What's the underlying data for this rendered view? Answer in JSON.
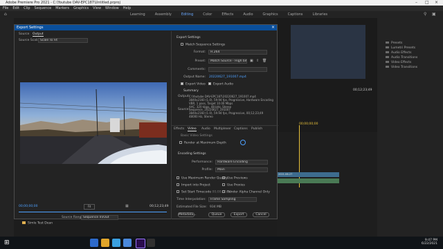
{
  "window": {
    "title": "Adobe Premiere Pro 2021 - C:\\Youtube DAV-EPC187\\Untitled.prproj"
  },
  "menu": [
    "File",
    "Edit",
    "Clip",
    "Sequence",
    "Markers",
    "Graphics",
    "View",
    "Window",
    "Help"
  ],
  "workspaces": [
    "Learning",
    "Assembly",
    "Editing",
    "Color",
    "Effects",
    "Audio",
    "Graphics",
    "Captions",
    "Libraries"
  ],
  "effects_panel": {
    "items": [
      "Presets",
      "Lumetri Presets",
      "Audio Effects",
      "Audio Transitions",
      "Video Effects",
      "Video Transitions"
    ]
  },
  "monitor": {
    "timecode": "00;12;23;49"
  },
  "timeline": {
    "timecode": "00;00;00;00",
    "clip_label": "2021-06-27"
  },
  "dialog": {
    "title": "Export Settings",
    "tabs": [
      "Source",
      "Output"
    ],
    "source_scaling_label": "Source Scaling:",
    "source_scaling_value": "Scale To Fit",
    "timecode_start": "00;00;00;00",
    "timecode_end": "00;12;23;49",
    "fit_label": "Fit",
    "source_range_label": "Source Range:",
    "source_range_value": "Sequence In/Out",
    "export_settings": {
      "header": "Export Settings",
      "match_sequence": "Match Sequence Settings",
      "format_label": "Format:",
      "format_value": "H.264",
      "preset_label": "Preset:",
      "preset_value": "Match Source - High bitrate",
      "comments_label": "Comments:",
      "output_name_label": "Output Name:",
      "output_name_value": "20220627_191007.mp4",
      "export_video": "Export Video",
      "export_audio": "Export Audio"
    },
    "summary": {
      "header": "Summary",
      "output_label": "Output:",
      "output_text": "C:\\Youtube DAV-EPC187\\20220627_191007.mp4\n3840x2160 (1.0), 59.94 fps, Progressive, Hardware Encoding\nVBR, 1 pass, Target 10.00 Mbps\nAAC, 320 kbps, 48 kHz, Stereo",
      "source_label": "Source:",
      "source_text": "Sequence, 20220627_191007\n3840x2160 (1.0), 59.94 fps, Progressive, 00;12;23;49\n48000 Hz, Stereo"
    },
    "settings_tabs": [
      "Effects",
      "Video",
      "Audio",
      "Multiplexer",
      "Captions",
      "Publish"
    ],
    "basic_video": "Basic Video Settings",
    "render_max_depth": "Render at Maximum Depth",
    "encoding_header": "Encoding Settings",
    "performance_label": "Performance:",
    "performance_value": "Hardware Encoding",
    "profile_label": "Profile:",
    "profile_value": "Main",
    "options": {
      "use_max_render": "Use Maximum Render Quality",
      "use_previews": "Use Previews",
      "import_into_project": "Import into Project",
      "use_proxies": "Use Proxies",
      "set_start_timecode": "Set Start Timecode",
      "start_timecode_value": "00;00;00;00",
      "render_alpha": "Render Alpha Channel Only"
    },
    "time_interp_label": "Time Interpolation:",
    "time_interp_value": "Frame Sampling",
    "file_size_label": "Estimated File Size:",
    "file_size_value": "934 MB",
    "buttons": {
      "metadata": "Metadata...",
      "queue": "Queue",
      "export": "Export",
      "cancel": "Cancel"
    }
  },
  "bin_item": "Simle Test Dean",
  "taskbar": {
    "time": "9:47 PM",
    "date": "6/22/2021"
  },
  "colors": {
    "accent": "#0a4f9b",
    "timecode": "#4ea1ff",
    "playhead": "#e8c13a"
  }
}
